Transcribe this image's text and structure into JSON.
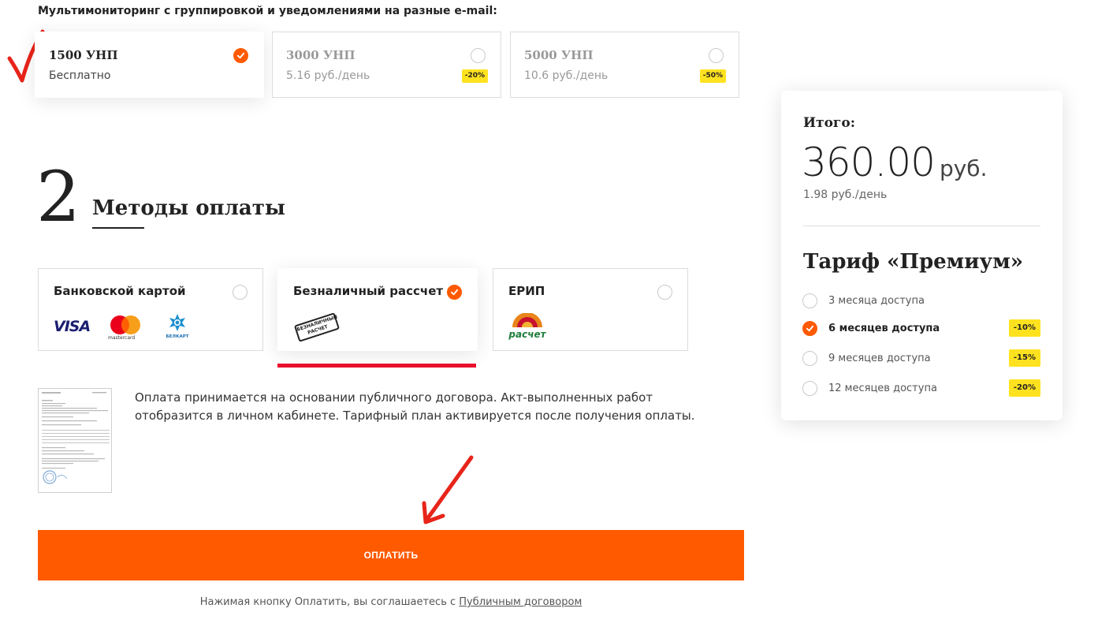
{
  "multimonitoring": {
    "title": "Мультимониторинг с группировкой и уведомлениями на разные e-mail:",
    "plans": [
      {
        "name": "1500 УНП",
        "price": "Бесплатно",
        "selected": true,
        "badge": ""
      },
      {
        "name": "3000 УНП",
        "price": "5.16 руб./день",
        "selected": false,
        "badge": "-20%"
      },
      {
        "name": "5000 УНП",
        "price": "10.6 руб./день",
        "selected": false,
        "badge": "-50%"
      }
    ]
  },
  "payment": {
    "step_number": "2",
    "title": "Методы оплаты",
    "methods": [
      {
        "name": "Банковской картой",
        "selected": false,
        "logos": [
          "VISA",
          "mastercard",
          "БЕЛКАРТ"
        ]
      },
      {
        "name": "Безналичный рассчет",
        "selected": true,
        "stamp": "БЕЗНАЛИЧНЫЙ РАСЧЕТ"
      },
      {
        "name": "ЕРИП",
        "selected": false,
        "logo_text": "расчет"
      }
    ],
    "info": "Оплата принимается на основании публичного договора. Акт-выполненных работ отобразится в личном кабинете. Тарифный план активируется после получения оплаты.",
    "pay_button": "ОПЛАТИТЬ",
    "agree_text": "Нажимая кнопку Оплатить, вы соглашаетесь с ",
    "agree_link": "Публичным договором"
  },
  "summary": {
    "label": "Итого:",
    "amount": "360.00",
    "currency": "руб.",
    "per_day": "1.98 руб./день",
    "tariff_title": "Тариф «Премиум»",
    "options": [
      {
        "label": "3 месяца доступа",
        "checked": false,
        "badge": ""
      },
      {
        "label": "6 месяцев доступа",
        "checked": true,
        "badge": "-10%"
      },
      {
        "label": "9 месяцев доступа",
        "checked": false,
        "badge": "-15%"
      },
      {
        "label": "12 месяцев доступа",
        "checked": false,
        "badge": "-20%"
      }
    ]
  },
  "colors": {
    "accent": "#ff5a00",
    "badge": "#ffe21f",
    "tab_underline": "#e8112d",
    "annotation_red": "#e8241a"
  }
}
